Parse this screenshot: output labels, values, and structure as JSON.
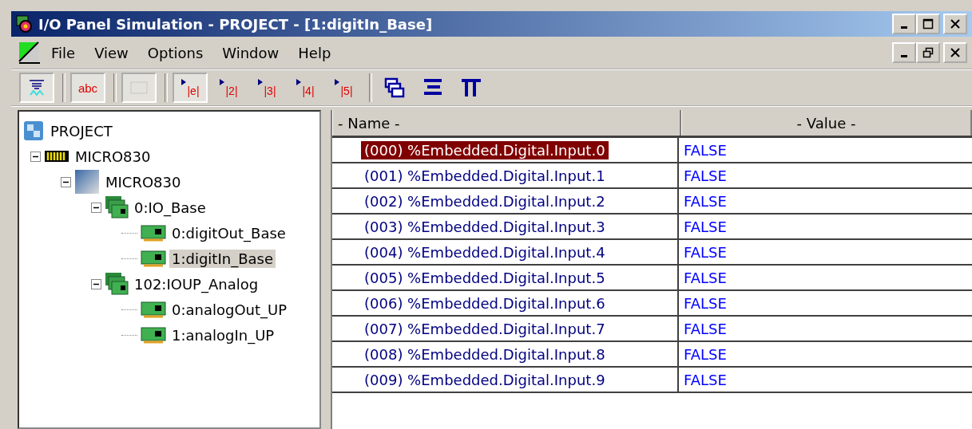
{
  "window": {
    "title": "I/O Panel Simulation - PROJECT - [1:digitIn_Base]"
  },
  "menu": [
    "File",
    "View",
    "Options",
    "Window",
    "Help"
  ],
  "toolbar": [
    [
      {
        "kind": "view",
        "pressed": true
      }
    ],
    [
      {
        "kind": "text",
        "label": "abc",
        "pressed": true
      }
    ],
    [
      {
        "kind": "grid",
        "pressed": true
      }
    ],
    [
      {
        "kind": "index",
        "label": "|e|",
        "pressed": true
      },
      {
        "kind": "index",
        "label": "|2|",
        "pressed": false
      },
      {
        "kind": "index",
        "label": "|3|",
        "pressed": false
      },
      {
        "kind": "index",
        "label": "|4|",
        "pressed": false
      },
      {
        "kind": "index",
        "label": "|5|",
        "pressed": false
      }
    ],
    [
      {
        "kind": "cascade",
        "pressed": false
      },
      {
        "kind": "rows",
        "pressed": false
      },
      {
        "kind": "columns",
        "pressed": false
      }
    ]
  ],
  "tree": [
    {
      "label": "PROJECT",
      "kind": "project",
      "selected": false,
      "children": [
        {
          "label": "MICRO830",
          "kind": "controller",
          "selected": false,
          "expanded": true,
          "children": [
            {
              "label": "MICRO830",
              "kind": "cpu",
              "selected": false,
              "expanded": true,
              "children": [
                {
                  "label": "0:IO_Base",
                  "kind": "modules",
                  "selected": false,
                  "expanded": true,
                  "children": [
                    {
                      "label": "0:digitOut_Base",
                      "kind": "module",
                      "selected": false
                    },
                    {
                      "label": "1:digitIn_Base",
                      "kind": "module",
                      "selected": true
                    }
                  ]
                },
                {
                  "label": "102:IOUP_Analog",
                  "kind": "modules",
                  "selected": false,
                  "expanded": true,
                  "children": [
                    {
                      "label": "0:analogOut_UP",
                      "kind": "module",
                      "selected": false
                    },
                    {
                      "label": "1:analogIn_UP",
                      "kind": "module",
                      "selected": false
                    }
                  ]
                }
              ]
            }
          ]
        }
      ]
    }
  ],
  "table": {
    "columns": [
      "- Name -",
      "- Value -"
    ],
    "rows": [
      {
        "name": "(000) %Embedded.Digital.Input.0",
        "value": "FALSE",
        "selected": true
      },
      {
        "name": "(001) %Embedded.Digital.Input.1",
        "value": "FALSE",
        "selected": false
      },
      {
        "name": "(002) %Embedded.Digital.Input.2",
        "value": "FALSE",
        "selected": false
      },
      {
        "name": "(003) %Embedded.Digital.Input.3",
        "value": "FALSE",
        "selected": false
      },
      {
        "name": "(004) %Embedded.Digital.Input.4",
        "value": "FALSE",
        "selected": false
      },
      {
        "name": "(005) %Embedded.Digital.Input.5",
        "value": "FALSE",
        "selected": false
      },
      {
        "name": "(006) %Embedded.Digital.Input.6",
        "value": "FALSE",
        "selected": false
      },
      {
        "name": "(007) %Embedded.Digital.Input.7",
        "value": "FALSE",
        "selected": false
      },
      {
        "name": "(008) %Embedded.Digital.Input.8",
        "value": "FALSE",
        "selected": false
      },
      {
        "name": "(009) %Embedded.Digital.Input.9",
        "value": "FALSE",
        "selected": false
      }
    ]
  }
}
